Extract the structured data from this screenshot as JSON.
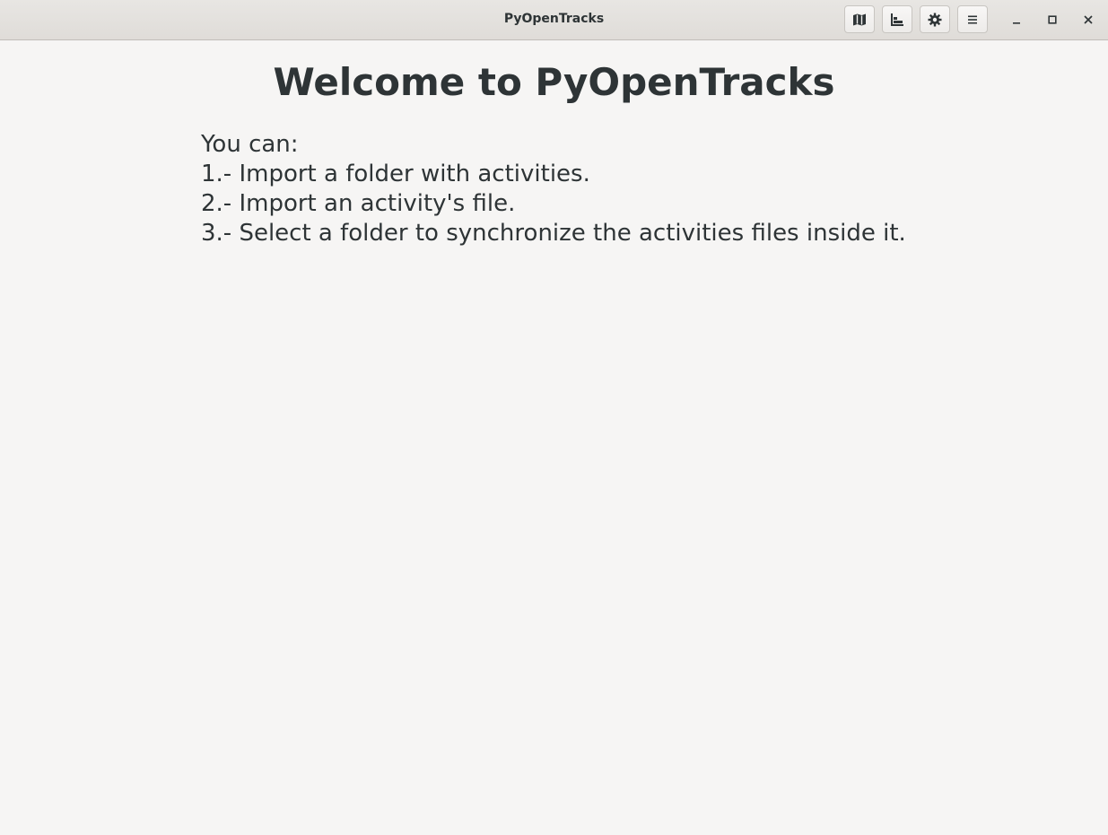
{
  "window": {
    "title": "PyOpenTracks"
  },
  "headerbar": {
    "buttons": [
      {
        "name": "map-button",
        "icon": "map-icon"
      },
      {
        "name": "stats-button",
        "icon": "chart-icon"
      },
      {
        "name": "preferences-button",
        "icon": "gear-icon"
      },
      {
        "name": "menu-button",
        "icon": "hamburger-menu-icon"
      }
    ],
    "window_controls": [
      {
        "name": "minimize-button",
        "icon": "minimize-icon"
      },
      {
        "name": "maximize-button",
        "icon": "maximize-icon"
      },
      {
        "name": "close-button",
        "icon": "close-icon"
      }
    ]
  },
  "main": {
    "heading": "Welcome to PyOpenTracks",
    "intro": "You can:",
    "steps": [
      "1.- Import a folder with activities.",
      "2.- Import an activity's file.",
      "3.- Select a folder to synchronize the activities files inside it."
    ]
  },
  "colors": {
    "background": "#f6f5f4",
    "text": "#2e3436",
    "headerbar": "#e8e6e3"
  }
}
